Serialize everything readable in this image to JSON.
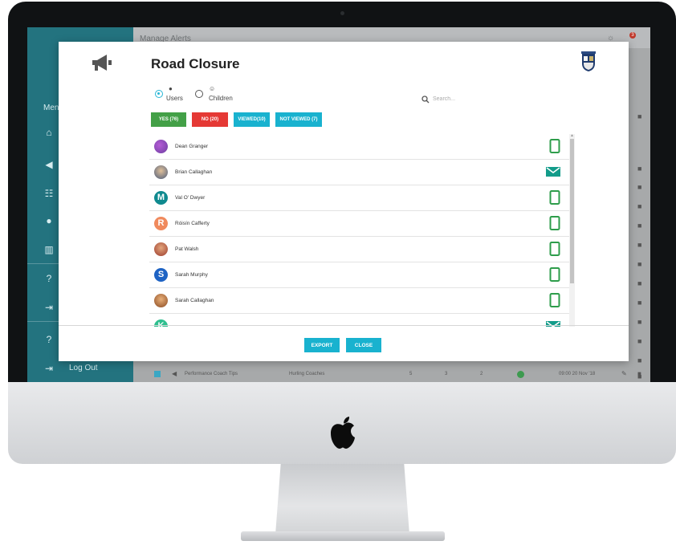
{
  "app": {
    "header_title": "Manage Alerts",
    "notification_count": "3",
    "sidebar": {
      "menu_label": "Menu",
      "logout_label": "Log Out"
    },
    "background_row": {
      "title": "Performance Coach Tips",
      "group": "Hurling Coaches",
      "col1": "5",
      "col2": "3",
      "col3": "2",
      "time": "09:00 20 Nov '18"
    }
  },
  "modal": {
    "title": "Road Closure",
    "radio_options": [
      {
        "label": "Users",
        "selected": true
      },
      {
        "label": "Children",
        "selected": false
      }
    ],
    "search": {
      "placeholder": "Search..."
    },
    "filters": [
      {
        "label": "YES (76)",
        "color": "#43a047"
      },
      {
        "label": "NO (20)",
        "color": "#e53935"
      },
      {
        "label": "VIEWED(10)",
        "color": "#19b2cf"
      },
      {
        "label": "NOT VIEWED (7)",
        "color": "#19b2cf"
      }
    ],
    "recipients": [
      {
        "name": "Dean Granger",
        "avatar": "photo",
        "channel": "phone-icon"
      },
      {
        "name": "Brian Callaghan",
        "avatar": "photo",
        "channel": "email-icon"
      },
      {
        "name": "Val O' Dwyer",
        "avatar": "M",
        "channel": "phone-icon"
      },
      {
        "name": "Róisín Cafferty",
        "avatar": "R",
        "channel": "phone-icon"
      },
      {
        "name": "Pat Walsh",
        "avatar": "photo",
        "channel": "phone-icon"
      },
      {
        "name": "Sarah Murphy",
        "avatar": "S",
        "channel": "phone-icon"
      },
      {
        "name": "Sarah Callaghan",
        "avatar": "photo",
        "channel": "phone-icon"
      },
      {
        "name": "",
        "avatar": "K",
        "channel": "email-icon"
      }
    ],
    "export_label": "EXPORT",
    "close_label": "CLOSE"
  },
  "colors": {
    "accent": "#19b2cf",
    "sidebar": "#23737f",
    "channel_green": "#2e9d4b",
    "email_teal": "#139c8a"
  }
}
